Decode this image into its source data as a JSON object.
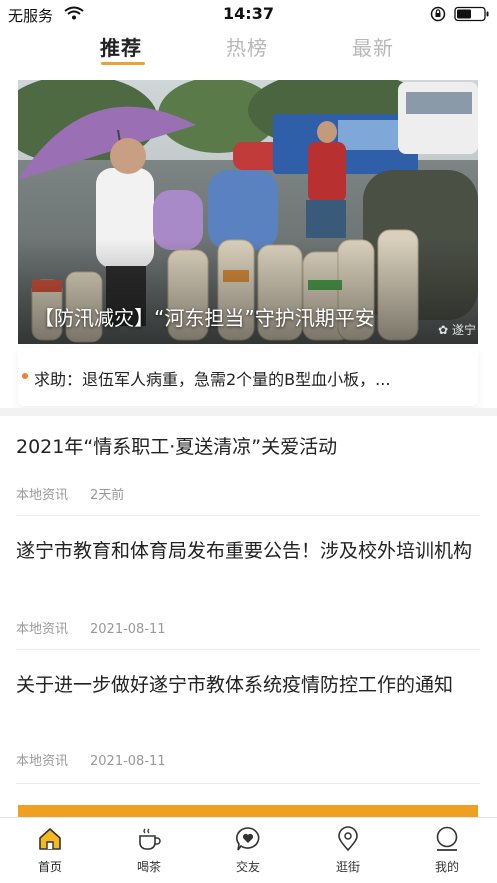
{
  "status": {
    "carrier": "无服务",
    "time": "14:37"
  },
  "tabs": [
    {
      "label": "推荐",
      "active": true
    },
    {
      "label": "热榜",
      "active": false
    },
    {
      "label": "最新",
      "active": false
    }
  ],
  "colors": {
    "accent": "#f0a030",
    "text_primary": "#222222",
    "text_muted": "#999999",
    "tab_inactive": "#b8b8b8"
  },
  "banner": {
    "caption": "【防汛减灾】“河东担当”守护汛期平安",
    "watermark": "遂宁"
  },
  "ticker": {
    "text": "求助：退伍军人病重，急需2个量的B型血小板，..."
  },
  "news": [
    {
      "title": "2021年“情系职工·夏送清凉”关爱活动",
      "source": "本地资讯",
      "date": "2天前"
    },
    {
      "title": "遂宁市教育和体育局发布重要公告！涉及校外培训机构",
      "source": "本地资讯",
      "date": "2021-08-11"
    },
    {
      "title": "关于进一步做好遂宁市教体系统疫情防控工作的通知",
      "source": "本地资讯",
      "date": "2021-08-11"
    }
  ],
  "bottom_nav": [
    {
      "label": "首页",
      "icon": "home-icon",
      "active": true
    },
    {
      "label": "喝茶",
      "icon": "tea-cup-icon",
      "active": false
    },
    {
      "label": "交友",
      "icon": "chat-heart-icon",
      "active": false
    },
    {
      "label": "逛街",
      "icon": "location-pin-icon",
      "active": false
    },
    {
      "label": "我的",
      "icon": "profile-icon",
      "active": false
    }
  ]
}
